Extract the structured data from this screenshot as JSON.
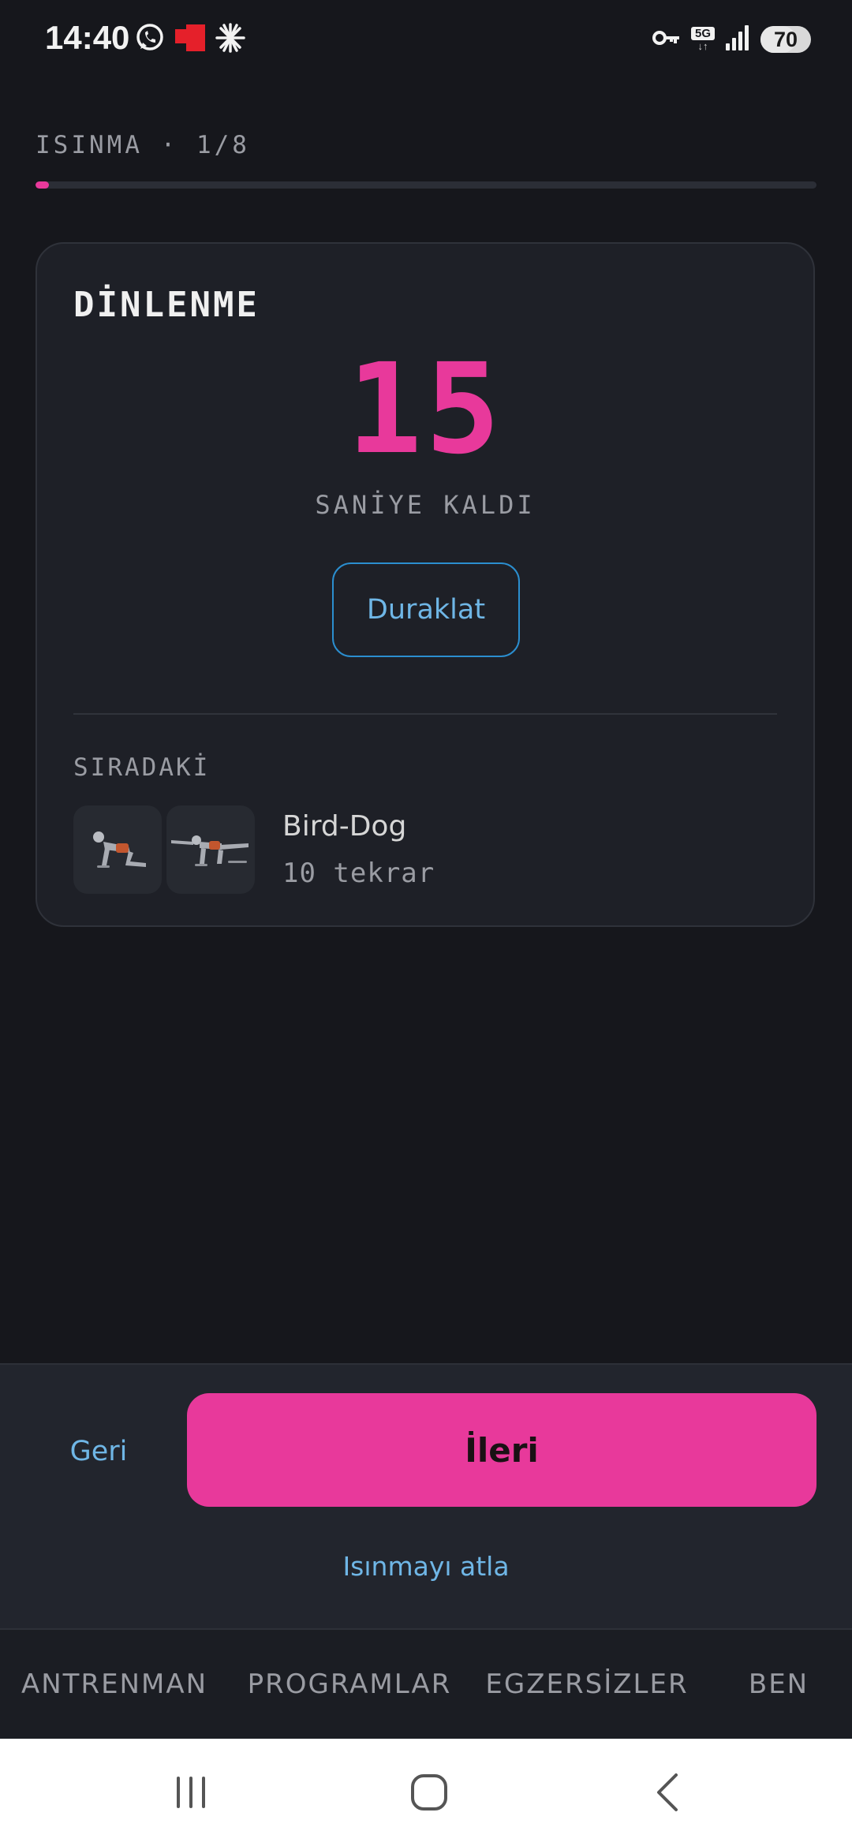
{
  "status_bar": {
    "time": "14:40",
    "battery_level": "70",
    "network_label": "5G",
    "left_icons": [
      "whatsapp-icon",
      "red-app-icon",
      "sparkle-icon"
    ],
    "right_icons": [
      "vpn-key-icon",
      "network-5g-icon",
      "signal-icon",
      "battery-icon"
    ]
  },
  "header": {
    "section_label": "ISINMA · 1/8",
    "progress_fraction": 0.0175
  },
  "rest_card": {
    "title": "DİNLENME",
    "countdown": "15",
    "countdown_caption": "SANİYE KALDI",
    "pause_label": "Duraklat",
    "next_label": "SIRADAKİ",
    "next_exercise": {
      "name": "Bird-Dog",
      "reps": "10 tekrar"
    }
  },
  "actions": {
    "back_label": "Geri",
    "next_label": "İleri",
    "skip_label": "Isınmayı atla"
  },
  "tabs": [
    {
      "label": "ANTRENMAN"
    },
    {
      "label": "PROGRAMLAR"
    },
    {
      "label": "EGZERSİZLER"
    },
    {
      "label": "BEN"
    }
  ],
  "colors": {
    "accent": "#e8399b",
    "link": "#6fb6e6",
    "background": "#16171c",
    "card": "#1e2027"
  }
}
